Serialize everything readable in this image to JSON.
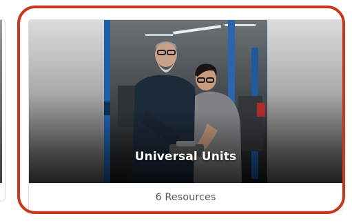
{
  "card": {
    "title": "Universal Units",
    "resources_label": "6 Resources"
  },
  "colors": {
    "highlight_border": "#c9371d",
    "title_text": "#ffffff",
    "footer_text": "#555555",
    "card_border": "#dcdcdc"
  }
}
